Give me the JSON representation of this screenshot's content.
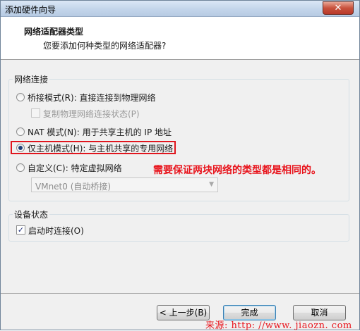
{
  "window": {
    "title": "添加硬件向导",
    "close_glyph": "✕"
  },
  "header": {
    "title": "网络适配器类型",
    "subtitle": "您要添加何种类型的网络适配器?"
  },
  "network_group": {
    "label": "网络连接",
    "bridged": "桥接模式(R): 直接连接到物理网络",
    "replicate": "复制物理网络连接状态(P)",
    "nat": "NAT 模式(N): 用于共享主机的 IP 地址",
    "host_only": "仅主机模式(H): 与主机共享的专用网络",
    "custom": "自定义(C): 特定虚拟网络",
    "custom_select": "VMnet0 (自动桥接)",
    "selected": "host_only"
  },
  "annotation": "需要保证两块网络的类型都是相同的。",
  "device_group": {
    "label": "设备状态",
    "connect_on_start": "启动时连接(O)",
    "connect_checked": true
  },
  "buttons": {
    "back": "< 上一步(B)",
    "finish": "完成",
    "cancel": "取消"
  },
  "watermark": "来源: http: //www. jiaozn. com",
  "colors": {
    "highlight": "#e0161e",
    "annotation": "#e8141c"
  }
}
